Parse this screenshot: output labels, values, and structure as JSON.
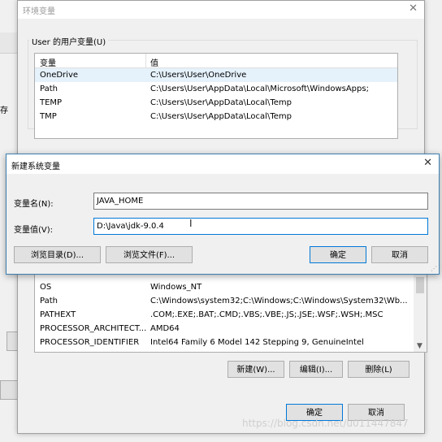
{
  "background": {
    "left_label": "存"
  },
  "env_dialog": {
    "title": "环境变量",
    "close_icon": "✕",
    "user_group_label": "User 的用户变量(U)",
    "user_list": {
      "headers": [
        "变量",
        "值"
      ],
      "rows": [
        {
          "name": "OneDrive",
          "value": "C:\\Users\\User\\OneDrive",
          "selected": true
        },
        {
          "name": "Path",
          "value": "C:\\Users\\User\\AppData\\Local\\Microsoft\\WindowsApps;"
        },
        {
          "name": "TEMP",
          "value": "C:\\Users\\User\\AppData\\Local\\Temp"
        },
        {
          "name": "TMP",
          "value": "C:\\Users\\User\\AppData\\Local\\Temp"
        }
      ]
    },
    "system_list": {
      "rows": [
        {
          "name": "OS",
          "value": "Windows_NT"
        },
        {
          "name": "Path",
          "value": "C:\\Windows\\system32;C:\\Windows;C:\\Windows\\System32\\Wb..."
        },
        {
          "name": "PATHEXT",
          "value": ".COM;.EXE;.BAT;.CMD;.VBS;.VBE;.JS;.JSE;.WSF;.WSH;.MSC"
        },
        {
          "name": "PROCESSOR_ARCHITECT...",
          "value": "AMD64"
        },
        {
          "name": "PROCESSOR_IDENTIFIER",
          "value": "Intel64 Family 6 Model 142 Stepping 9, GenuineIntel"
        }
      ]
    },
    "system_buttons": {
      "new": "新建(W)...",
      "edit": "编辑(I)...",
      "delete": "删除(L)"
    },
    "ok": "确定",
    "cancel": "取消"
  },
  "new_dialog": {
    "title": "新建系统变量",
    "close_icon": "✕",
    "name_label": "变量名(N):",
    "name_value": "JAVA_HOME",
    "value_label": "变量值(V):",
    "value_value": "D:\\Java\\jdk-9.0.4",
    "browse_dir": "浏览目录(D)...",
    "browse_file": "浏览文件(F)...",
    "ok": "确定",
    "cancel": "取消"
  },
  "watermark": "https://blog.csdn.net/u011447847"
}
